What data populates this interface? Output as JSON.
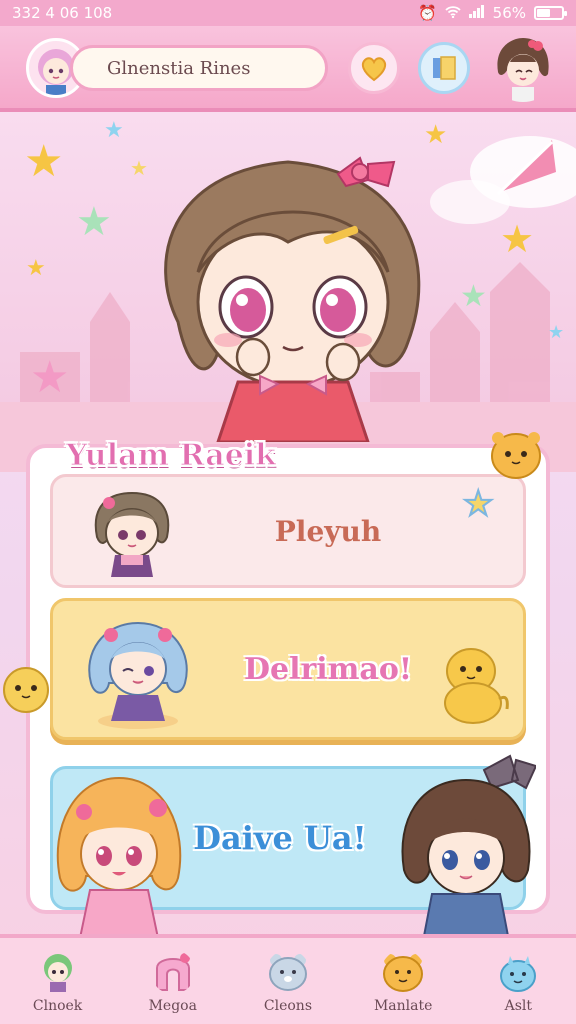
{
  "status_bar": {
    "time": "332 4 06 108",
    "battery": "56%",
    "battery_level": 0.56
  },
  "header": {
    "title": "Glnenstia Rines"
  },
  "card": {
    "title": "Yulam Raeik",
    "options": [
      {
        "label": "Pleyuh"
      },
      {
        "label": "Delrimao!"
      },
      {
        "label": "Daive Ua!"
      }
    ]
  },
  "nav": {
    "items": [
      {
        "label": "Clnoek",
        "icon": "green-hair-chibi-icon"
      },
      {
        "label": "Megoa",
        "icon": "pink-arch-icon"
      },
      {
        "label": "Cleons",
        "icon": "bear-face-icon"
      },
      {
        "label": "Manlate",
        "icon": "yellow-bear-icon"
      },
      {
        "label": "Aslt",
        "icon": "blue-creature-icon"
      }
    ]
  },
  "colors": {
    "accent": "#f3a9cc",
    "title_pink": "#e26fb0",
    "yellow": "#fbe3a1",
    "blue": "#bfe8f6"
  }
}
